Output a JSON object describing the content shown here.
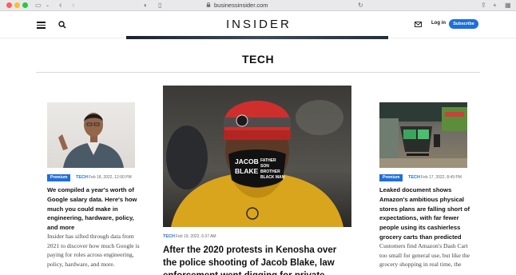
{
  "browser": {
    "url": "businessinsider.com"
  },
  "header": {
    "logo": "INSIDER",
    "login_label": "Log in",
    "subscribe_label": "Subscribe"
  },
  "section": {
    "title": "TECH"
  },
  "articles": [
    {
      "badge": "Premium",
      "category": "TECH",
      "date": "Feb 18, 2022, 12:00 PM",
      "headline": "We compiled a year's worth of Google salary data. Here's how much you could make in engineering, hardware, policy, and more",
      "excerpt": "Insider has sifted through data from 2021 to discover how much Google is paying for roles across engineering, policy, hardware, and more."
    },
    {
      "category": "TECH",
      "date": "Feb 19, 2022, 6:37 AM",
      "headline": "After the 2020 protests in Kenosha over the police shooting of Jacob Blake, law enforcement went digging for private",
      "mask_text": "JACOB BLAKE FATHER SON BROTHER BLACK MAN"
    },
    {
      "badge": "Premium",
      "category": "TECH",
      "date": "Feb 17, 2022, 8:49 PM",
      "headline": "Leaked document shows Amazon's ambitious physical stores plans are falling short of expectations, with far fewer people using its cashierless grocery carts than predicted",
      "excerpt": "Customers find Amazon's Dash Cart too small for general use, but like the                   grocery shopping in real time, the"
    }
  ],
  "colors": {
    "accent": "#1f6fd8",
    "rule": "#d9d9d9"
  }
}
